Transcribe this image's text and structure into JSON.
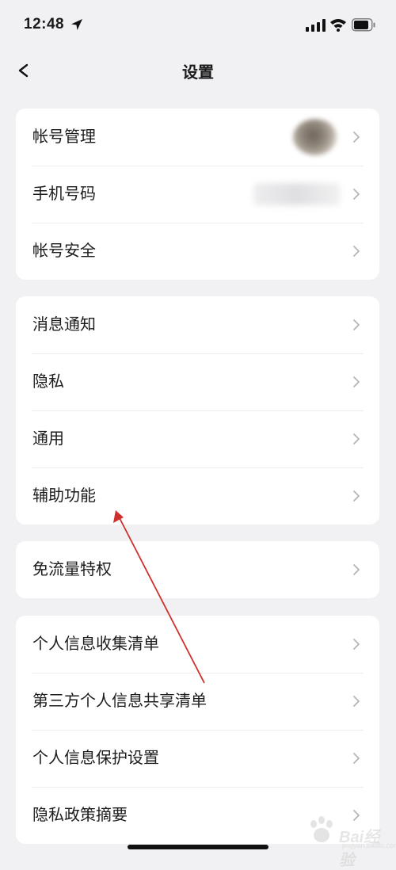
{
  "status_bar": {
    "time": "12:48"
  },
  "nav": {
    "title": "设置"
  },
  "groups": [
    {
      "items": [
        {
          "label": "帐号管理"
        },
        {
          "label": "手机号码"
        },
        {
          "label": "帐号安全"
        }
      ]
    },
    {
      "items": [
        {
          "label": "消息通知"
        },
        {
          "label": "隐私"
        },
        {
          "label": "通用"
        },
        {
          "label": "辅助功能"
        }
      ]
    },
    {
      "items": [
        {
          "label": "免流量特权"
        }
      ]
    },
    {
      "items": [
        {
          "label": "个人信息收集清单"
        },
        {
          "label": "第三方个人信息共享清单"
        },
        {
          "label": "个人信息保护设置"
        },
        {
          "label": "隐私政策摘要"
        }
      ]
    }
  ],
  "watermark": {
    "brand": "Bai经验",
    "domain": "jingyan.baidu.com"
  },
  "colors": {
    "background": "#f1f1f3",
    "card": "#ffffff",
    "annotation_arrow": "#d0302b",
    "chevron": "#b5b5b5"
  }
}
